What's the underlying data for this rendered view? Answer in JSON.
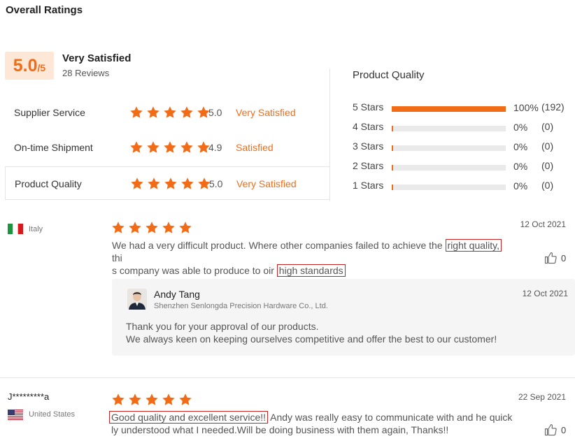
{
  "header": {
    "title": "Overall Ratings"
  },
  "overall": {
    "score": "5.0",
    "score_suffix": "/5",
    "label": "Very Satisfied",
    "review_count": "28 Reviews"
  },
  "categories": [
    {
      "name": "Supplier Service",
      "score": "5.0",
      "verdict": "Very Satisfied",
      "stars": 5
    },
    {
      "name": "On-time Shipment",
      "score": "4.9",
      "verdict": "Satisfied",
      "stars": 5
    },
    {
      "name": "Product Quality",
      "score": "5.0",
      "verdict": "Very Satisfied",
      "stars": 5,
      "selected": true
    }
  ],
  "product_quality": {
    "title": "Product Quality",
    "distribution": [
      {
        "label": "5 Stars",
        "percent": "100%",
        "count": "(192)",
        "fill": 1.0
      },
      {
        "label": "4 Stars",
        "percent": "0%",
        "count": "(0)",
        "fill": 0.0
      },
      {
        "label": "3 Stars",
        "percent": "0%",
        "count": "(0)",
        "fill": 0.0
      },
      {
        "label": "2 Stars",
        "percent": "0%",
        "count": "(0)",
        "fill": 0.0
      },
      {
        "label": "1 Stars",
        "percent": "0%",
        "count": "(0)",
        "fill": 0.0
      }
    ]
  },
  "reviews": [
    {
      "country": "Italy",
      "date": "12 Oct 2021",
      "stars": 5,
      "text_line1_pre": "We had a very difficult product. Where other companies failed to achieve the ",
      "text_line1_hl": "right quality,",
      "text_line1_post": " thi",
      "text_line2_pre": "s company was able to produce to oir ",
      "text_line2_hl": "high standards",
      "likes": "0",
      "reply": {
        "name": "Andy Tang",
        "company": "Shenzhen Senlongda Precision Hardware Co., Ltd.",
        "date": "12 Oct 2021",
        "line1": "Thank you for your approval of our products.",
        "line2": "We always keen on keeping ourselves competitive and offer the best to our customer!"
      }
    },
    {
      "reviewer": "J*********a",
      "country": "United States",
      "date": "22 Sep 2021",
      "stars": 5,
      "text_line1_hl": "Good quality and excellent service!!",
      "text_line1_post": " Andy was really easy to communicate with and he quick",
      "text_line2": "ly understood what I needed.Will be doing business with them again, Thanks!!",
      "likes": "0"
    }
  ],
  "colors": {
    "accent": "#f26c18",
    "score_bg": "#fde8d8",
    "highlight_border": "#cc2222"
  },
  "icons": [
    "star-icon",
    "thumbs-up-icon",
    "flag-italy-icon",
    "flag-us-icon",
    "avatar"
  ]
}
